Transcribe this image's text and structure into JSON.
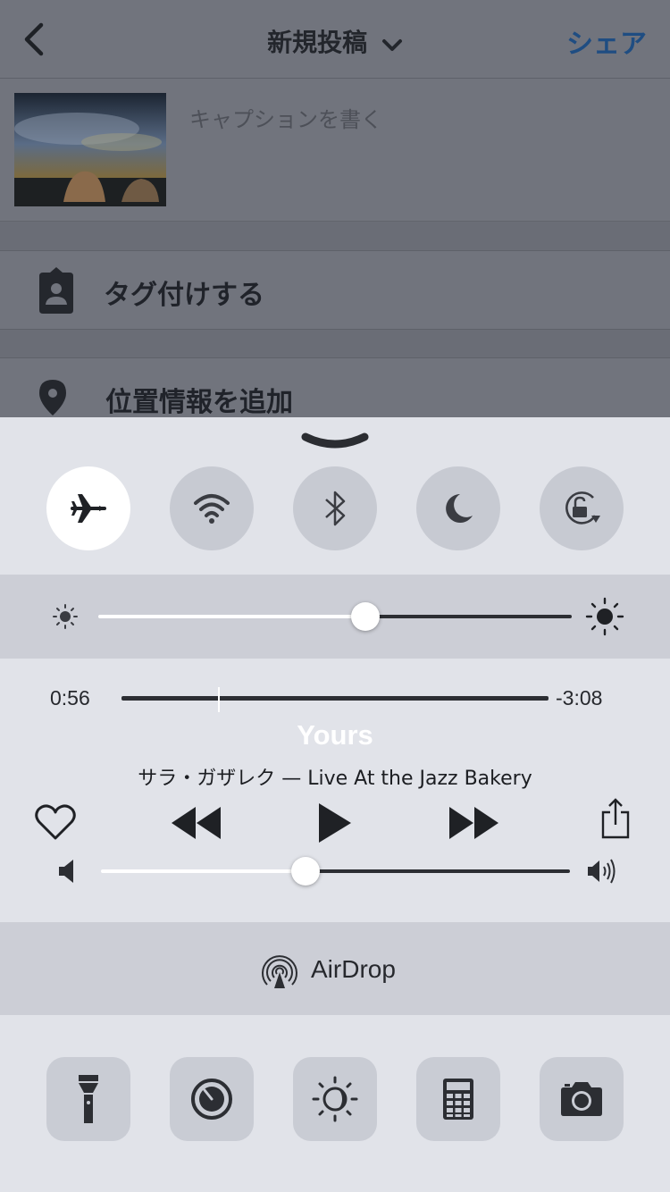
{
  "app": {
    "header": {
      "title": "新規投稿",
      "share_label": "シェア"
    },
    "post": {
      "caption_placeholder": "キャプションを書く"
    },
    "rows": {
      "tag_label": "タグ付けする",
      "location_label": "位置情報を追加"
    }
  },
  "control_center": {
    "toggles": [
      {
        "name": "airplane-mode",
        "icon": "airplane-icon",
        "active": true
      },
      {
        "name": "wifi",
        "icon": "wifi-icon",
        "active": false
      },
      {
        "name": "bluetooth",
        "icon": "bluetooth-icon",
        "active": false
      },
      {
        "name": "do-not-disturb",
        "icon": "moon-icon",
        "active": false
      },
      {
        "name": "rotation-lock",
        "icon": "rotation-lock-icon",
        "active": false
      }
    ],
    "brightness": {
      "level_percent": 57
    },
    "now_playing": {
      "elapsed": "0:56",
      "remaining": "-3:08",
      "title": "Yours",
      "artist_album": "サラ・ガザレク — Live At the Jazz Bakery",
      "progress_percent": 23
    },
    "volume": {
      "level_percent": 44
    },
    "airdrop": {
      "label": "AirDrop"
    },
    "tools": [
      {
        "name": "flashlight",
        "icon": "flashlight-icon"
      },
      {
        "name": "timer",
        "icon": "timer-icon"
      },
      {
        "name": "night-shift",
        "icon": "night-shift-icon"
      },
      {
        "name": "calculator",
        "icon": "calculator-icon"
      },
      {
        "name": "camera",
        "icon": "camera-icon"
      }
    ],
    "colors": {
      "panel": "#e1e3e9",
      "band": "#ccced6",
      "button": "#c7cad2",
      "active_button": "#ffffff",
      "share_accent": "#1f4d82"
    }
  }
}
